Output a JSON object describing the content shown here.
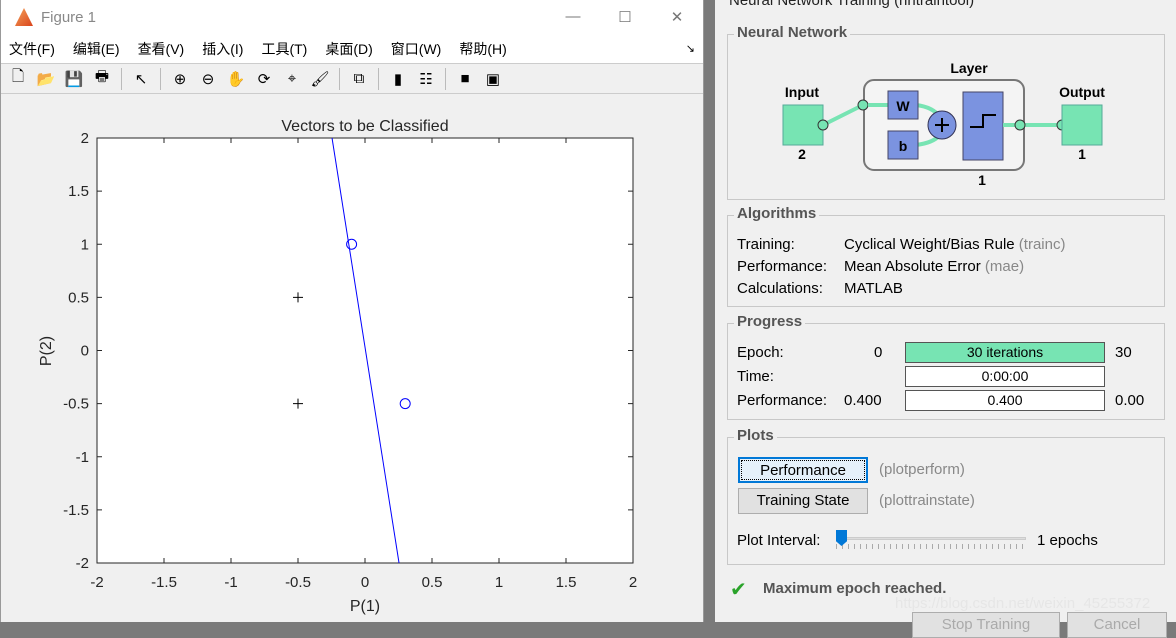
{
  "figure_window": {
    "title": "Figure 1",
    "controls": {
      "minimize": "—",
      "maximize": "☐",
      "close": "✕"
    },
    "menu": [
      "文件(F)",
      "编辑(E)",
      "查看(V)",
      "插入(I)",
      "工具(T)",
      "桌面(D)",
      "窗口(W)",
      "帮助(H)"
    ],
    "menu_corner": "↘",
    "toolbar": [
      {
        "name": "new-figure-icon",
        "glyph": "🗋"
      },
      {
        "name": "open-file-icon",
        "glyph": "📂"
      },
      {
        "name": "save-icon",
        "glyph": "💾"
      },
      {
        "name": "print-icon",
        "glyph": "🖶"
      },
      {
        "name": "pointer-icon",
        "glyph": "↖"
      },
      {
        "name": "zoom-in-icon",
        "glyph": "⊕"
      },
      {
        "name": "zoom-out-icon",
        "glyph": "⊖"
      },
      {
        "name": "pan-icon",
        "glyph": "✋"
      },
      {
        "name": "rotate-icon",
        "glyph": "⟳"
      },
      {
        "name": "data-cursor-icon",
        "glyph": "⌖"
      },
      {
        "name": "brush-icon",
        "glyph": "🖌"
      },
      {
        "name": "link-plot-icon",
        "glyph": "⧉"
      },
      {
        "name": "colorbar-icon",
        "glyph": "▮"
      },
      {
        "name": "legend-icon",
        "glyph": "☷"
      },
      {
        "name": "hide-plot-tools-icon",
        "glyph": "■"
      },
      {
        "name": "show-plot-tools-icon",
        "glyph": "▣"
      }
    ]
  },
  "chart_data": {
    "type": "scatter",
    "title": "Vectors to be Classified",
    "xlabel": "P(1)",
    "ylabel": "P(2)",
    "xlim": [
      -2,
      2
    ],
    "ylim": [
      -2,
      2
    ],
    "xticks": [
      "-2",
      "-1.5",
      "-1",
      "-0.5",
      "0",
      "0.5",
      "1",
      "1.5",
      "2"
    ],
    "yticks": [
      "2",
      "1.5",
      "1",
      "0.5",
      "0",
      "-0.5",
      "-1",
      "-1.5",
      "-2"
    ],
    "grid": false,
    "points": [
      {
        "x": -0.5,
        "y": 0.5,
        "marker": "+",
        "color": "#000000"
      },
      {
        "x": -0.5,
        "y": -0.5,
        "marker": "+",
        "color": "#000000"
      },
      {
        "x": -0.1,
        "y": 1,
        "marker": "o",
        "color": "#0000ff"
      },
      {
        "x": 0.3,
        "y": -0.5,
        "marker": "o",
        "color": "#0000ff"
      }
    ],
    "decision_line": {
      "x": [
        -0.246,
        0.254
      ],
      "y": [
        2,
        -2
      ],
      "color": "#0000ff"
    }
  },
  "nntool": {
    "title": "Neural Network Training (nntraintool)",
    "network": {
      "group": "Neural Network",
      "input_label": "Input",
      "input_size": "2",
      "layer_label": "Layer",
      "layer_size": "1",
      "weight": "W",
      "bias": "b",
      "output_label": "Output",
      "output_size": "1",
      "color_io": "#77e4b3",
      "color_block": "#7b93e0"
    },
    "algorithms": {
      "group": "Algorithms",
      "rows": [
        {
          "label": "Training:",
          "value": "Cyclical Weight/Bias Rule",
          "fn": "(trainc)"
        },
        {
          "label": "Performance:",
          "value": "Mean Absolute Error",
          "fn": "(mae)"
        },
        {
          "label": "Calculations:",
          "value": "MATLAB",
          "fn": ""
        }
      ]
    },
    "progress": {
      "group": "Progress",
      "epoch": {
        "label": "Epoch:",
        "min": "0",
        "text": "30 iterations",
        "max": "30",
        "fraction": 1.0
      },
      "time": {
        "label": "Time:",
        "text": "0:00:00"
      },
      "performance": {
        "label": "Performance:",
        "min": "0.400",
        "text": "0.400",
        "max": "0.00"
      }
    },
    "plots": {
      "group": "Plots",
      "buttons": [
        {
          "label": "Performance",
          "fn": "(plotperform)"
        },
        {
          "label": "Training State",
          "fn": "(plottrainstate)"
        }
      ],
      "interval_label": "Plot Interval:",
      "interval_value": "1 epochs",
      "interval_fraction": 0
    },
    "status": "Maximum epoch reached.",
    "bottom_buttons": [
      "Stop Training",
      "Cancel"
    ],
    "watermark": "https://blog.csdn.net/weixin_45255372"
  }
}
